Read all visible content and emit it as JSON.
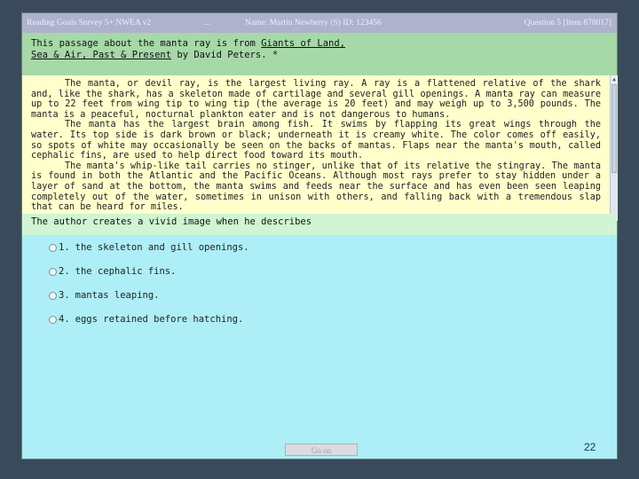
{
  "titlebar": {
    "survey": "Reading Goals Survey 5+ NWEA v2",
    "separator": "...",
    "name": "Name: Martin Newberry (S)   ID: 123456",
    "question": "Question 5 [Item 878017]"
  },
  "prompt": {
    "lead": "This passage about the manta ray is from ",
    "source_title": "Giants of Land,",
    "book_line": "Sea & Air, Past & Present",
    "trail": " by David Peters. *"
  },
  "passage": {
    "paragraphs": [
      "The manta, or devil ray, is the largest living ray. A ray is a flattened relative of the shark and, like the shark, has a skeleton made of cartilage and several gill openings. A manta ray can measure up to 22 feet from wing tip to wing tip (the average is 20 feet) and may weigh up to 3,500 pounds. The manta is a peaceful, nocturnal plankton eater and is not dangerous to humans.",
      "The manta has the largest brain among fish. It swims by flapping its great wings through the water. Its top side is dark brown or black; underneath it is creamy white. The color comes off easily, so spots of white may occasionally be seen on the backs of mantas. Flaps near the manta's mouth, called cephalic fins, are used to help direct food toward its mouth.",
      "The manta's whip-like tail carries no stinger, unlike that of its relative the stingray. The manta is found in both the Atlantic and the Pacific Oceans. Although most rays prefer to stay hidden under a layer of sand at the bottom, the manta swims and feeds near the surface and has even been seen leaping completely out of the water, sometimes in unison with others, and falling back with a tremendous slap that can be heard for miles."
    ]
  },
  "stem": "The author creates a vivid image when he describes",
  "choices": [
    {
      "num": "1.",
      "text": "the skeleton and gill openings."
    },
    {
      "num": "2.",
      "text": "the cephalic fins."
    },
    {
      "num": "3.",
      "text": "mantas leaping."
    },
    {
      "num": "4.",
      "text": "eggs retained before hatching."
    }
  ],
  "footer": {
    "button_label": "Go on"
  },
  "page_number": "22",
  "colors": {
    "titlebar": "#aeb2cc",
    "prompt_bg": "#a6d8a8",
    "passage_bg": "#ffffcc",
    "answer_area_bg": "#aeeef6",
    "page_number": "#1f2e70"
  },
  "icons": {
    "scroll_up": "up-arrow-icon",
    "scroll_down": "down-arrow-icon",
    "radio": "radio-button-icon"
  }
}
